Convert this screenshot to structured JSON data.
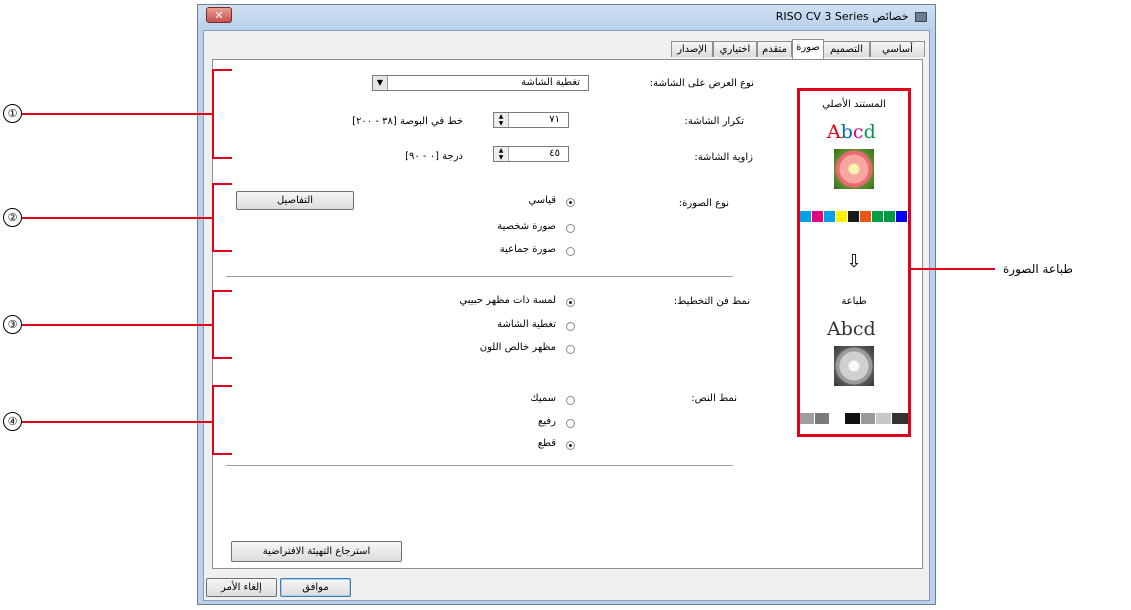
{
  "window": {
    "title": "خصائص RISO CV 3 Series",
    "close_glyph": "✕"
  },
  "tabs": [
    {
      "label": "أساسي"
    },
    {
      "label": "التصميم"
    },
    {
      "label": "صورة"
    },
    {
      "label": "متقدم"
    },
    {
      "label": "اختياري"
    },
    {
      "label": "الإصدار"
    }
  ],
  "screen": {
    "display_type_label": "نوع العرض على الشاشة:",
    "display_type_value": "تغطية الشاشة",
    "frequency_label": "تكرار الشاشة:",
    "frequency_value": "٧١",
    "frequency_unit": "خط في البوصة [٣٨ - ٢٠٠]",
    "angle_label": "زاوية الشاشة:",
    "angle_value": "٤٥",
    "angle_unit": "درجة [٠ - ٩٠]"
  },
  "image_type": {
    "label": "نوع الصورة:",
    "details_button": "التفاصيل",
    "options": [
      "قياسي",
      "صورة شخصية",
      "صورة جماعية"
    ],
    "selected": 0
  },
  "line_pattern": {
    "label": "نمط فن التخطيط:",
    "options": [
      "لمسة ذات مظهر حبيبي",
      "تغطية الشاشة",
      "مظهر خالص اللون"
    ],
    "selected": 0
  },
  "text_pattern": {
    "label": "نمط النص:",
    "options": [
      "سميك",
      "رفيع",
      "قطع"
    ],
    "selected": 2
  },
  "restore_button": "استرجاع التهيئة الافتراضية",
  "ok_button": "موافق",
  "cancel_button": "إلغاء الأمر",
  "preview": {
    "original_title": "المستند الأصلي",
    "sample_text": "Abcd",
    "arrow_glyph": "⇩",
    "print_title": "طباعة",
    "color_swatches": [
      "#00a0e9",
      "#e4007f",
      "#00a0e9",
      "#fff100",
      "#1a1a1a",
      "#e95513",
      "#00a040",
      "#009944",
      "#0000ff"
    ],
    "gray_swatches": [
      "#9e9e9e",
      "#7a7a7a",
      "#ffffff",
      "#111111",
      "#9a9a9a",
      "#c8c8c8",
      "#333333"
    ],
    "sample_text_colors": [
      "#e60012",
      "#0068b7",
      "#e4007f",
      "#009944"
    ]
  },
  "annotations": {
    "markers": [
      "①",
      "②",
      "③",
      "④"
    ],
    "callout": "طباعة الصورة"
  },
  "colors": {
    "accent": "#e2001a"
  }
}
